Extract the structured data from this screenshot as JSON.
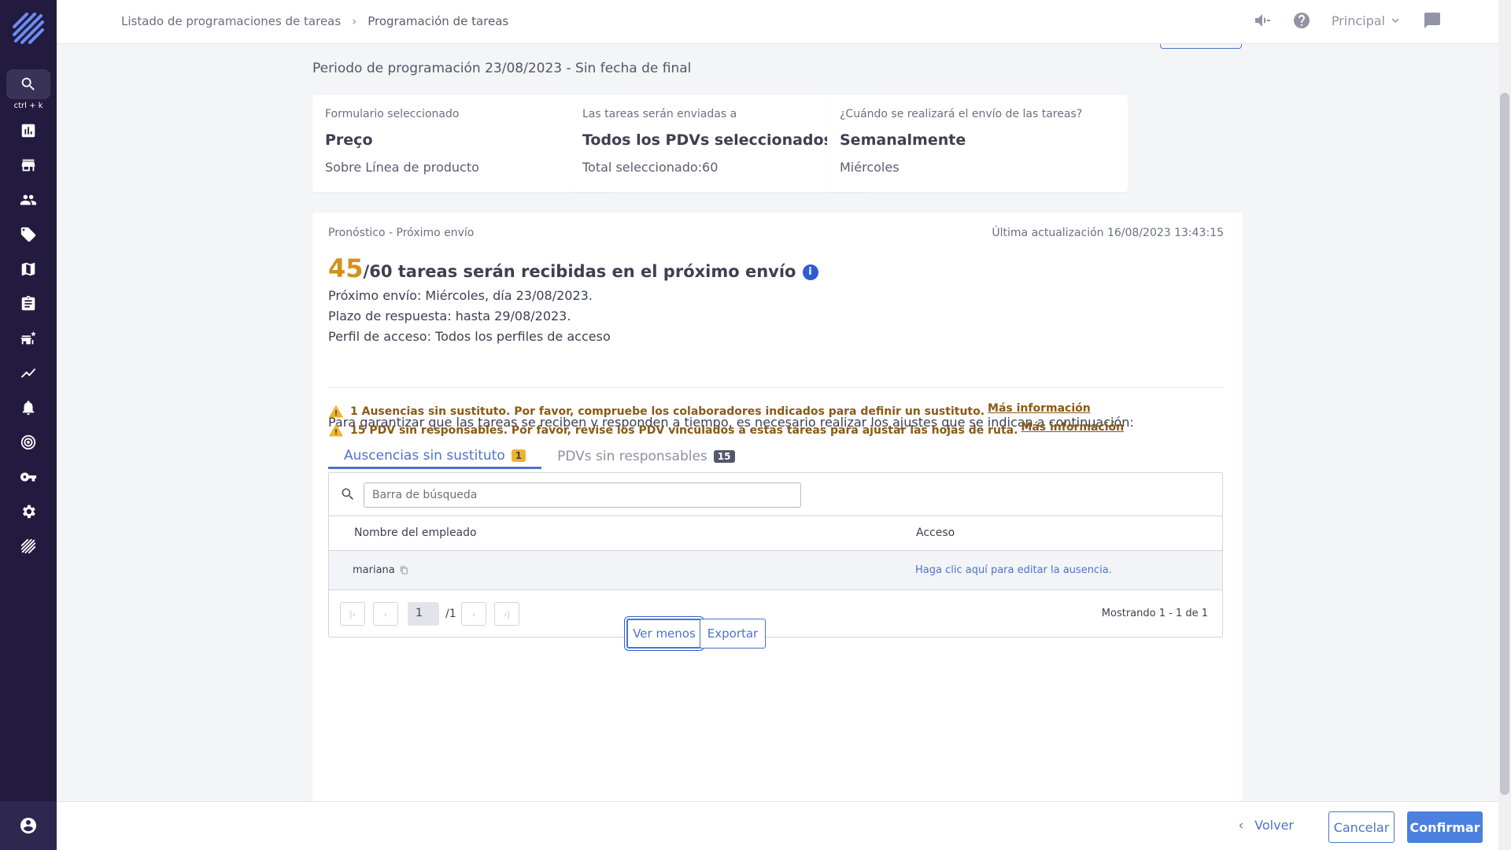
{
  "sidebar": {
    "search_hint": "ctrl + k",
    "items": [
      {
        "icon": "dashboard-icon"
      },
      {
        "icon": "store-icon"
      },
      {
        "icon": "people-icon"
      },
      {
        "icon": "tag-icon"
      },
      {
        "icon": "map-icon"
      },
      {
        "icon": "clipboard-icon"
      },
      {
        "icon": "store-star-icon"
      },
      {
        "icon": "trending-icon"
      },
      {
        "icon": "bell-icon"
      },
      {
        "icon": "target-icon"
      },
      {
        "icon": "key-icon"
      },
      {
        "icon": "settings-icon"
      },
      {
        "icon": "logo-small-icon"
      }
    ]
  },
  "header": {
    "breadcrumb": [
      "Listado de programaciones de tareas",
      "Programación de tareas"
    ],
    "environment": "Principal"
  },
  "schedule": {
    "period": "Periodo de programación 23/08/2023 - Sin fecha de final"
  },
  "cards": [
    {
      "label": "Formulario seleccionado",
      "title": "Preço",
      "sub": "Sobre Línea de producto"
    },
    {
      "label": "Las tareas serán enviadas a",
      "title": "Todos los PDVs seleccionados",
      "sub": "Total seleccionado:60"
    },
    {
      "label": "¿Cuándo se realizará el envío de las tareas?",
      "title": "Semanalmente",
      "sub": "Miércoles"
    }
  ],
  "forecast": {
    "title": "Pronóstico - Próximo envío",
    "updated": "Última actualización 16/08/2023 13:43:15",
    "count": "45",
    "headline_rest": "/60 tareas serán recibidas en el próximo envío",
    "info": "i",
    "next_send": "Próximo envío: Miércoles, día 23/08/2023.",
    "deadline": "Plazo de respuesta: hasta 29/08/2023.",
    "profile": "Perfil de acceso: Todos los perfiles de acceso",
    "intro": "Para garantizar que las tareas se reciben y responden a tiempo, es necesario realizar los ajustes que se indican a continuación:",
    "warnings": [
      {
        "text": "1 Ausencias sin sustituto. Por favor, compruebe los colaboradores indicados para definir un sustituto.",
        "link": "Más información"
      },
      {
        "text": "15 PDV sin responsables. Por favor, revise los PDV vinculados a estas tareas para ajustar las hojas de ruta.",
        "link": "Más información"
      }
    ],
    "colors": {
      "count": "#d4901a",
      "warning": "#f1b32d",
      "accent": "#4b74c9"
    }
  },
  "tabs": [
    {
      "label": "Auscencias sin sustituto",
      "badge": "1",
      "active": true
    },
    {
      "label": "PDVs sin responsables",
      "badge": "15",
      "active": false
    }
  ],
  "table": {
    "search_placeholder": "Barra de búsqueda",
    "columns": [
      "Nombre del empleado",
      "Acceso"
    ],
    "rows": [
      {
        "name": "mariana",
        "access": "Haga clic aquí para editar la ausencia."
      }
    ],
    "page": "1",
    "total_pages": "/1",
    "showing": "Mostrando 1 - 1 de 1"
  },
  "actions": {
    "see_less": "Ver menos",
    "export": "Exportar"
  },
  "footer": {
    "back": "Volver",
    "cancel": "Cancelar",
    "confirm": "Confirmar"
  }
}
